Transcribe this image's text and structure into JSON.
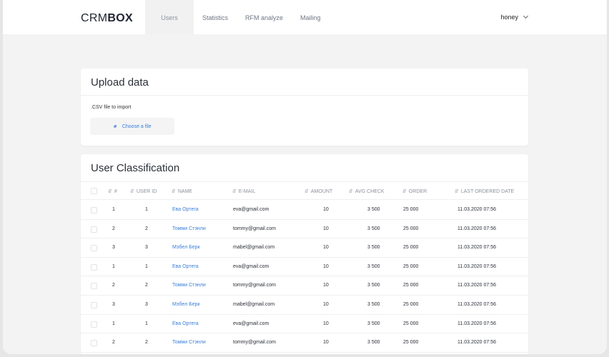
{
  "header": {
    "logo_thin": "CRM",
    "logo_bold": "BOX",
    "nav": [
      {
        "label": "Users",
        "active": true
      },
      {
        "label": "Statistics",
        "active": false
      },
      {
        "label": "RFM analyze",
        "active": false
      },
      {
        "label": "Mailing",
        "active": false
      }
    ],
    "user": "honey"
  },
  "upload": {
    "title": "Upload data",
    "label": ".CSV file to import",
    "button": "Choose a file"
  },
  "classification": {
    "title": "User Classification",
    "columns": [
      "#",
      "USER ID",
      "NAME",
      "E-MAIL",
      "AMOUNT",
      "AVG CHECK",
      "ORDER",
      "LAST ORDERED DATE"
    ],
    "rows": [
      {
        "num": "1",
        "user_id": "1",
        "name": "Ева Ортега",
        "email": "eva@gmail.com",
        "amount": "10",
        "avg_check": "3 500",
        "order": "25 000",
        "date": "11.03.2020 07:56"
      },
      {
        "num": "2",
        "user_id": "2",
        "name": "Томми Стэнли",
        "email": "tommy@gmail.com",
        "amount": "10",
        "avg_check": "3 500",
        "order": "25 000",
        "date": "11.03.2020 07:56"
      },
      {
        "num": "3",
        "user_id": "3",
        "name": "Мэбел Берк",
        "email": "mabel@gmail.com",
        "amount": "10",
        "avg_check": "3 500",
        "order": "25 000",
        "date": "11.03.2020 07:56"
      },
      {
        "num": "1",
        "user_id": "1",
        "name": "Ева Ортега",
        "email": "eva@gmail.com",
        "amount": "10",
        "avg_check": "3 500",
        "order": "25 000",
        "date": "11.03.2020 07:56"
      },
      {
        "num": "2",
        "user_id": "2",
        "name": "Томми Стэнли",
        "email": "tommy@gmail.com",
        "amount": "10",
        "avg_check": "3 500",
        "order": "25 000",
        "date": "11.03.2020 07:56"
      },
      {
        "num": "3",
        "user_id": "3",
        "name": "Мэбел Берк",
        "email": "mabel@gmail.com",
        "amount": "10",
        "avg_check": "3 500",
        "order": "25 000",
        "date": "11.03.2020 07:56"
      },
      {
        "num": "1",
        "user_id": "1",
        "name": "Ева Ортега",
        "email": "eva@gmail.com",
        "amount": "10",
        "avg_check": "3 500",
        "order": "25 000",
        "date": "11.03.2020 07:56"
      },
      {
        "num": "2",
        "user_id": "2",
        "name": "Томми Стэнли",
        "email": "tommy@gmail.com",
        "amount": "10",
        "avg_check": "3 500",
        "order": "25 000",
        "date": "11.03.2020 07:56"
      }
    ]
  },
  "colors": {
    "accent": "#3b7fd9",
    "background": "#f3f3f4",
    "card": "#ffffff"
  },
  "icons": {
    "sort": "sort-icon",
    "link": "link-icon",
    "chevron": "chevron-down-icon"
  }
}
